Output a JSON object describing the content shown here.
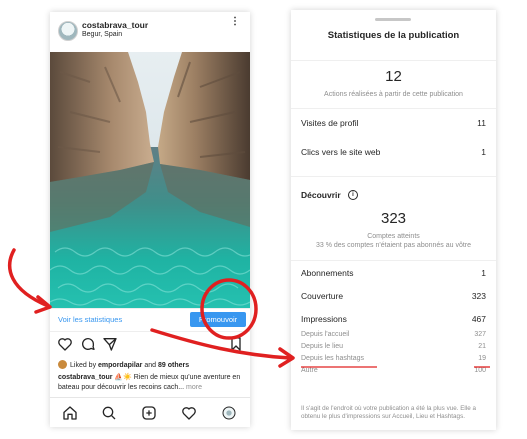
{
  "post": {
    "username": "costabrava_tour",
    "location": "Begur, Spain",
    "more_icon": "⋮",
    "view_stats_label": "Voir les statistiques",
    "promote_label": "Promouvoir",
    "liked_by_prefix": "Liked by",
    "liked_by_user": "empordapilar",
    "liked_by_and": "and",
    "liked_by_others": "89 others",
    "caption_user": "costabrava_tour",
    "caption_text": "⛵☀️ Rien de mieux qu'une aventure en bateau pour découvrir les recoins cach...",
    "caption_more": "more"
  },
  "insights": {
    "title": "Statistiques de la publication",
    "actions_count": "12",
    "actions_desc": "Actions réalisées à partir de cette publication",
    "profile_visits_label": "Visites de profil",
    "profile_visits_value": "11",
    "website_clicks_label": "Clics vers le site web",
    "website_clicks_value": "1",
    "discovery_label": "Découvrir",
    "info_icon": "i",
    "reached_count": "323",
    "reached_label": "Comptes atteints",
    "reached_desc": "33 % des comptes n'étaient pas abonnés au vôtre",
    "follows_label": "Abonnements",
    "follows_value": "1",
    "reach_label": "Couverture",
    "reach_value": "323",
    "impressions_label": "Impressions",
    "impressions_value": "467",
    "from_home_label": "Depuis l'accueil",
    "from_home_value": "327",
    "from_location_label": "Depuis le lieu",
    "from_location_value": "21",
    "from_hashtags_label": "Depuis les hashtags",
    "from_hashtags_value": "19",
    "other_label": "Autre",
    "other_value": "100",
    "footnote": "Il s'agit de l'endroit où votre publication a été la plus vue. Elle a obtenu le plus d'impressions sur Accueil, Lieu et Hashtags."
  },
  "colors": {
    "accent_blue": "#3897f0",
    "annotation_red": "#e02020"
  }
}
